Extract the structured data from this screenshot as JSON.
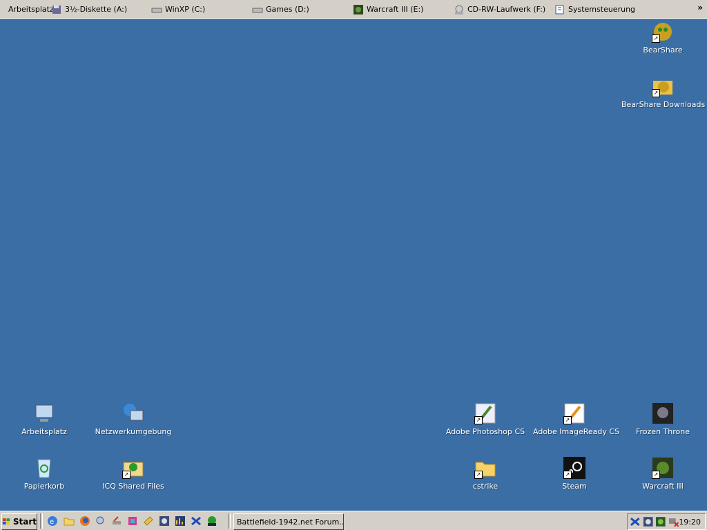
{
  "topbar": {
    "items": [
      {
        "label": "Arbeitsplatz"
      },
      {
        "label": "3½-Diskette (A:)"
      },
      {
        "label": "WinXP (C:)"
      },
      {
        "label": "Games (D:)"
      },
      {
        "label": "Warcraft III (E:)"
      },
      {
        "label": "CD-RW-Laufwerk (F:)"
      },
      {
        "label": "Systemsteuerung"
      }
    ],
    "chevron": "»"
  },
  "desktop": {
    "icons": [
      {
        "label": "BearShare"
      },
      {
        "label": "BearShare Downloads"
      },
      {
        "label": "Arbeitsplatz"
      },
      {
        "label": "Netzwerkumgebung"
      },
      {
        "label": "Adobe Photoshop CS"
      },
      {
        "label": "Adobe ImageReady CS"
      },
      {
        "label": "Frozen Throne"
      },
      {
        "label": "Papierkorb"
      },
      {
        "label": "ICQ Shared Files"
      },
      {
        "label": "cstrike"
      },
      {
        "label": "Steam"
      },
      {
        "label": "Warcraft III"
      }
    ]
  },
  "taskbar": {
    "start_label": "Start",
    "task_label": "Battlefield-1942.net Forum...",
    "clock": "19:20"
  },
  "colors": {
    "desktop": "#3a6ea5",
    "bar": "#d4d0c8"
  }
}
